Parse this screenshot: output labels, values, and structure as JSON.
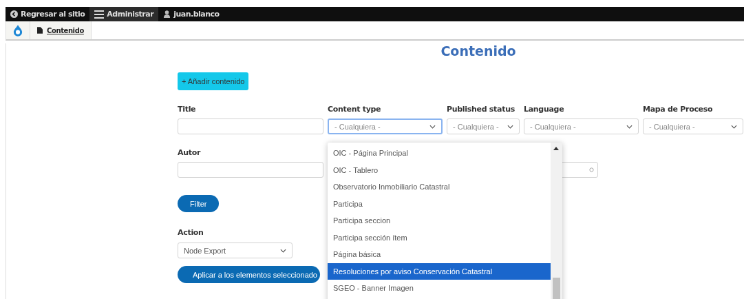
{
  "toolbar": {
    "items": [
      {
        "kind": "back",
        "label": "Regresar al sitio",
        "selected": false
      },
      {
        "kind": "menu",
        "label": "Administrar",
        "selected": true
      },
      {
        "kind": "user",
        "label": "juan.blanco",
        "selected": false
      }
    ]
  },
  "tray": {
    "link": "Contenido"
  },
  "page": {
    "title": "Contenido",
    "add_button": "+ Añadir contenido"
  },
  "filters": [
    {
      "label": "Title",
      "kind": "text"
    },
    {
      "label": "Content type",
      "kind": "select",
      "value": "- Cualquiera -",
      "focused": true
    },
    {
      "label": "Published status",
      "kind": "select",
      "value": "- Cualquiera -",
      "focused": false
    },
    {
      "label": "Language",
      "kind": "select",
      "value": "- Cualquiera -",
      "focused": false
    },
    {
      "label": "Mapa de Proceso",
      "kind": "select",
      "value": "- Cualquiera -",
      "focused": false
    }
  ],
  "autor": {
    "label": "Autor"
  },
  "filter_button": "Filter",
  "action": {
    "label": "Action",
    "value": "Node Export",
    "apply_button": "Aplicar a los elementos seleccionado"
  },
  "dropdown": {
    "options": [
      {
        "label": "OIC - Página Principal",
        "selected": false
      },
      {
        "label": "OIC - Tablero",
        "selected": false
      },
      {
        "label": "Observatorio Inmobiliario Catastral",
        "selected": false
      },
      {
        "label": "Participa",
        "selected": false
      },
      {
        "label": "Participa seccion",
        "selected": false
      },
      {
        "label": "Participa sección ítem",
        "selected": false
      },
      {
        "label": "Página básica",
        "selected": false
      },
      {
        "label": "Resoluciones por aviso Conservación Catastral",
        "selected": true
      },
      {
        "label": "SGEO - Banner Imagen",
        "selected": false
      }
    ]
  }
}
